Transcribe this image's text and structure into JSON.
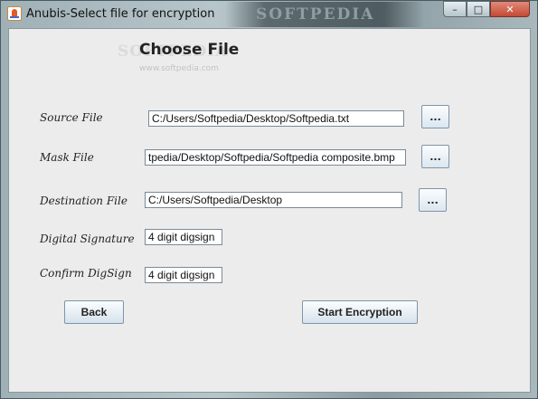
{
  "window": {
    "title": "Anubis-Select file for encryption",
    "watermark": "SOFTPEDIA",
    "controls": {
      "minimize": "–",
      "maximize": "□",
      "close": "✕"
    }
  },
  "page": {
    "heading": "Choose File",
    "watermark": "SOFTPEDIA",
    "watermark_url": "www.softpedia.com"
  },
  "form": {
    "source": {
      "label": "Source File",
      "value": "C:/Users/Softpedia/Desktop/Softpedia.txt",
      "browse": "..."
    },
    "mask": {
      "label": "Mask File",
      "value": "tpedia/Desktop/Softpedia/Softpedia composite.bmp",
      "browse": "..."
    },
    "destination": {
      "label": "Destination File",
      "value": "C:/Users/Softpedia/Desktop",
      "browse": "..."
    },
    "signature": {
      "label": "Digital Signature",
      "value": "4 digit digsign"
    },
    "confirm": {
      "label": "Confirm DigSign",
      "value": "4 digit digsign"
    }
  },
  "buttons": {
    "back": "Back",
    "start": "Start Encryption"
  },
  "icons": {
    "app": "java-coffee-icon"
  }
}
